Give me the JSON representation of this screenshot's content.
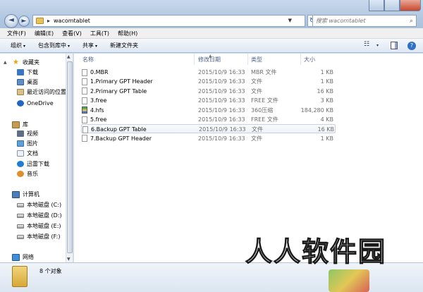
{
  "window": {
    "path_segment": "wacomtablet",
    "search_placeholder": "搜索 wacomtablet",
    "nav_back_glyph": "◄",
    "nav_forward_glyph": "►",
    "address_separator": "▸",
    "address_dropdown_glyph": "▼",
    "refresh_glyph": "↻",
    "search_icon_glyph": "⌕"
  },
  "menu": {
    "items": [
      "文件(F)",
      "编辑(E)",
      "查看(V)",
      "工具(T)",
      "帮助(H)"
    ]
  },
  "toolbar": {
    "organize": "组织",
    "include_library": "包含到库中",
    "share": "共享",
    "new_folder": "新建文件夹",
    "dropdown_glyph": "▾",
    "view_glyph": "☷",
    "help_glyph": "?"
  },
  "nav": {
    "favorites_label": "收藏夹",
    "favorites": [
      "下载",
      "桌面",
      "最近访问的位置"
    ],
    "onedrive": "OneDrive",
    "libraries_label": "库",
    "libraries": [
      "视频",
      "图片",
      "文档",
      "迅雷下载",
      "音乐"
    ],
    "computer_label": "计算机",
    "drives": [
      "本地磁盘 (C:)",
      "本地磁盘 (D:)",
      "本地磁盘 (E:)",
      "本地磁盘 (F:)"
    ],
    "network": "网络",
    "star_glyph": "★",
    "expand_glyph": "▲",
    "collapse_glyph": "▸",
    "scroll_up_glyph": "▲",
    "scroll_down_glyph": "▼"
  },
  "columns": {
    "name": "名称",
    "modified": "修改日期",
    "type": "类型",
    "size": "大小",
    "sort_glyph": "▲"
  },
  "files": [
    {
      "name": "0.MBR",
      "modified": "2015/10/9 16:33",
      "type": "MBR 文件",
      "size": "1 KB",
      "icon": "file-icon"
    },
    {
      "name": "1.Primary GPT Header",
      "modified": "2015/10/9 16:33",
      "type": "文件",
      "size": "1 KB",
      "icon": "file-icon"
    },
    {
      "name": "2.Primary GPT Table",
      "modified": "2015/10/9 16:33",
      "type": "文件",
      "size": "16 KB",
      "icon": "file-icon"
    },
    {
      "name": "3.free",
      "modified": "2015/10/9 16:33",
      "type": "FREE 文件",
      "size": "3 KB",
      "icon": "file-icon"
    },
    {
      "name": "4.hfs",
      "modified": "2015/10/9 16:33",
      "type": "360压缩",
      "size": "184,280 KB",
      "icon": "archive-icon"
    },
    {
      "name": "5.free",
      "modified": "2015/10/9 16:33",
      "type": "FREE 文件",
      "size": "4 KB",
      "icon": "file-icon"
    },
    {
      "name": "6.Backup GPT Table",
      "modified": "2015/10/9 16:33",
      "type": "文件",
      "size": "16 KB",
      "icon": "file-icon",
      "selected": true
    },
    {
      "name": "7.Backup GPT Header",
      "modified": "2015/10/9 16:33",
      "type": "文件",
      "size": "1 KB",
      "icon": "file-icon"
    }
  ],
  "status": {
    "count": "8 个对象"
  },
  "watermark": "人人软件园"
}
